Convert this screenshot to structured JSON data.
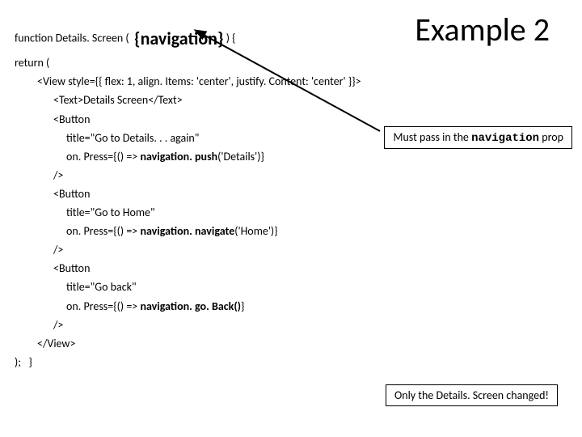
{
  "title": "Example 2",
  "code": {
    "fn_prefix": "function Details. Screen (  ",
    "fn_param": "{navigation}",
    "fn_suffix": " ) {",
    "return": "return (",
    "view_open": "<View style={{ flex: 1, align. Items: 'center', justify. Content: 'center' }}>",
    "text_line": "<Text>Details Screen</Text>",
    "button_open": "<Button",
    "title1": "title=\"Go to Details. . . again\"",
    "onpress1_pre": "on. Press={() => ",
    "onpress1_bold": "navigation. push",
    "onpress1_post": "('Details')}",
    "self_close": "/>",
    "title2": "title=\"Go to Home\"",
    "onpress2_pre": "on. Press={() => ",
    "onpress2_bold": "navigation. navigate",
    "onpress2_post": "('Home')}",
    "title3": "title=\"Go back\"",
    "onpress3_pre": "on. Press={() => ",
    "onpress3_bold": "navigation. go. Back()",
    "onpress3_post": "}",
    "view_close": "</View>",
    "close_paren": ");   }"
  },
  "callout1_pre": "Must pass in the ",
  "callout1_code": "navigation",
  "callout1_post": " prop",
  "callout2": "Only the Details. Screen changed!"
}
